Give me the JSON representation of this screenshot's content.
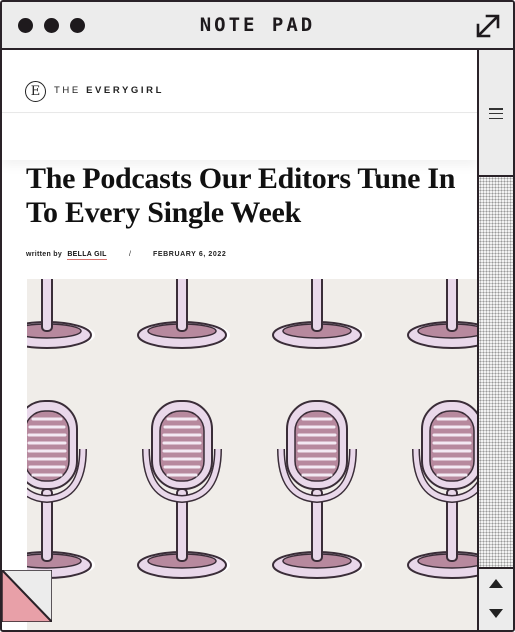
{
  "window": {
    "title": "NOTE PAD",
    "buttons": [
      "close-dot",
      "minimize-dot",
      "zoom-dot"
    ],
    "expand_icon": "expand-diagonal-arrow-icon"
  },
  "site": {
    "logo_mark": "E",
    "logo_text_prefix": "THE",
    "logo_text_brand": "EVERYGIRL"
  },
  "article": {
    "headline": "The Podcasts Our Editors Tune In To Every Single Week",
    "byline_prefix": "written by",
    "author": "BELLA GIL",
    "separator": "/",
    "date": "FEBRUARY 6, 2022",
    "hero_image": "pattern-of-vintage-microphones"
  },
  "scrollbar": {
    "menu_icon": "hamburger-menu-icon",
    "up_icon": "triangle-up-icon",
    "down_icon": "triangle-down-icon"
  },
  "colors": {
    "frame": "#2a2228",
    "chrome": "#ececec",
    "hero_bg": "#f0ede9",
    "mic_fill": "#e9d8ea",
    "mic_dark": "#b7899e",
    "corner_pink": "#e8a0a8"
  }
}
